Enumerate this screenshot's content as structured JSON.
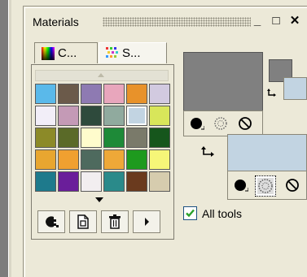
{
  "panel": {
    "title": "Materials"
  },
  "titlebar": {
    "minimize_glyph": "_",
    "maximize_glyph": "□",
    "close_glyph": "✕"
  },
  "tabs": [
    {
      "label": "C...",
      "icon": "color-spectrum-icon",
      "active": false
    },
    {
      "label": "S...",
      "icon": "swatches-icon",
      "active": true
    }
  ],
  "swatches": [
    "#5ab9ea",
    "#6b5a4a",
    "#8e7ab2",
    "#e8a6bc",
    "#e8922a",
    "#d2cae0",
    "#f2eef8",
    "#c49ab6",
    "#2e4a3c",
    "#90aa9e",
    "#c2d4e2",
    "#d8e65a",
    "#8c8a28",
    "#5a6a28",
    "#fffccc",
    "#1e8a38",
    "#7a7a6a",
    "#16561c",
    "#e8a630",
    "#f0a030",
    "#4e6a5e",
    "#eea838",
    "#1e9a1e",
    "#f6f678",
    "#1e7a8c",
    "#6a1e9a",
    "#f2eef0",
    "#2a8a8a",
    "#6a3a1e",
    "#d6ccae"
  ],
  "selected_swatch": "#c2d4e2",
  "colors": {
    "foreground": "#808080",
    "background": "#c2d4e2",
    "accent_check": "#2aa12a"
  },
  "bottom_buttons": [
    {
      "icon": "swatch-options-icon"
    },
    {
      "icon": "new-swatch-icon"
    },
    {
      "icon": "delete-swatch-icon"
    },
    {
      "icon": "more-arrow-icon"
    }
  ],
  "all_tools": {
    "label": "All tools",
    "checked": true
  }
}
